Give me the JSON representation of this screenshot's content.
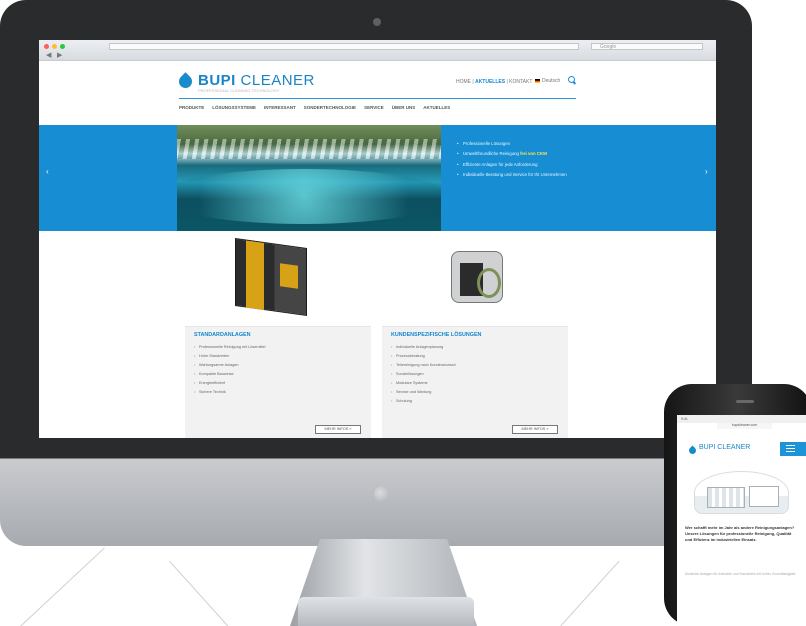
{
  "browser": {
    "search_placeholder": "Google"
  },
  "site": {
    "brand_primary": "BUPI",
    "brand_secondary": "CLEANER",
    "tagline": "PROFESSIONAL CLEANING TECHNOLOGY",
    "top_links": {
      "first": "HOME",
      "highlight": "AKTUELLES",
      "last": "KONTAKT"
    },
    "language": "Deutsch",
    "nav": [
      "PRODUKTE",
      "LÖSUNGSSYSTEME",
      "INTERESSANT",
      "SONDERTECHNOLOGIE",
      "SERVICE",
      "ÜBER UNS",
      "AKTUELLES"
    ],
    "hero": {
      "items": [
        {
          "text": "Professionelle Lösungen"
        },
        {
          "text": "Umweltfreundliche Reinigung",
          "highlight": "frei von CKW"
        },
        {
          "text": "Effiziente Anlagen für jede Anforderung"
        },
        {
          "text": "Individuelle Beratung und Service für Ihr Unternehmen"
        }
      ],
      "left_arrow": "‹",
      "right_arrow": "›"
    },
    "cards": [
      {
        "title": "STANDARDANLAGEN",
        "items": [
          "Professionelle Reinigung mit Lösemittel",
          "Hohe Standzeiten",
          "Wartungsarme Anlagen",
          "Kompakte Bauweise",
          "Energieeffizient",
          "Sichere Technik"
        ],
        "button": "MEHR INFOS »"
      },
      {
        "title": "KUNDENSPEZIFISCHE LÖSUNGEN",
        "items": [
          "Individuelle Anlagenplanung",
          "Prozessberatung",
          "Teilereinigung nach Kundenwunsch",
          "Sonderlösungen",
          "Modulare Systeme",
          "Service und Wartung",
          "Schulung"
        ],
        "button": "MEHR INFOS »"
      }
    ]
  },
  "phone": {
    "status_time": "9:41",
    "url": "bupicleaner.com",
    "brand": "BUPI CLEANER",
    "paragraph_strong": "Wer schafft mehr im Jahr als andere Reinigungsanlagen? Unsere Lösungen für professionelle Reinigung, Qualität und Effizienz im industriellen Einsatz.",
    "paragraph_light": "Moderne Anlagen für Industrie und Handwerk mit hoher Zuverlässigkeit."
  },
  "colors": {
    "brand_blue": "#178dd3",
    "accent_yellow": "#ffe84f",
    "machine_yellow": "#d8a217"
  },
  "icons": {
    "search": "search-icon",
    "menu": "menu-icon"
  }
}
